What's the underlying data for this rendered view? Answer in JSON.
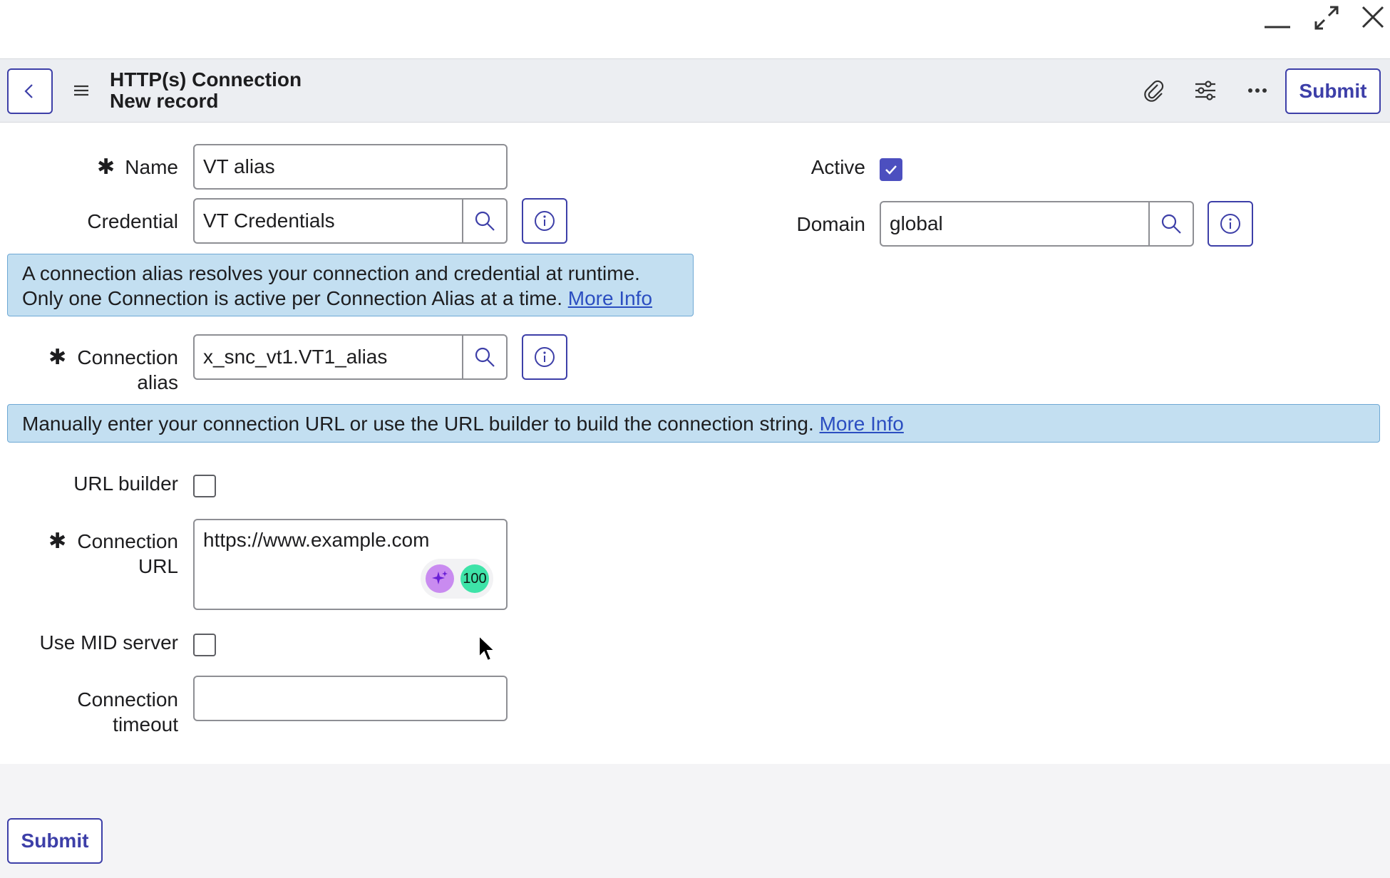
{
  "window": {
    "minimize_icon": "minimize-icon",
    "expand_icon": "expand-icon",
    "close_icon": "close-icon"
  },
  "header": {
    "title": "HTTP(s) Connection",
    "subtitle": "New record",
    "back_icon": "chevron-left-icon",
    "menu_icon": "hamburger-icon",
    "attachment_icon": "paperclip-icon",
    "settings_icon": "sliders-icon",
    "more_icon": "ellipsis-icon",
    "submit_label": "Submit"
  },
  "form": {
    "name": {
      "label": "Name",
      "value": "VT alias",
      "required": true
    },
    "active": {
      "label": "Active",
      "checked": true
    },
    "credential": {
      "label": "Credential",
      "value": "VT Credentials"
    },
    "domain": {
      "label": "Domain",
      "value": "global"
    },
    "alias_banner": {
      "text": "A connection alias resolves your connection and credential at runtime. Only one Connection is active per Connection Alias at a time. ",
      "link": "More Info"
    },
    "connection_alias": {
      "label_line1": "Connection",
      "label_line2": "alias",
      "value": "x_snc_vt1.VT1_alias",
      "required": true
    },
    "url_banner": {
      "text": "Manually enter your connection URL or use the URL builder to build the connection string. ",
      "link": "More Info"
    },
    "url_builder": {
      "label": "URL builder",
      "checked": false
    },
    "connection_url": {
      "label_line1": "Connection",
      "label_line2": "URL",
      "value": "https://www.example.com",
      "required": true,
      "badge_count": "100"
    },
    "use_mid_server": {
      "label": "Use MID server",
      "checked": false
    },
    "connection_timeout": {
      "label_line1": "Connection",
      "label_line2": "timeout",
      "value": ""
    }
  },
  "footer": {
    "submit_label": "Submit"
  },
  "colors": {
    "accent": "#3d3fa8",
    "banner_bg": "#c3dff1",
    "header_bg": "#eceef2",
    "badge_green": "#3ee3a8",
    "badge_purple": "#c98bf0"
  }
}
